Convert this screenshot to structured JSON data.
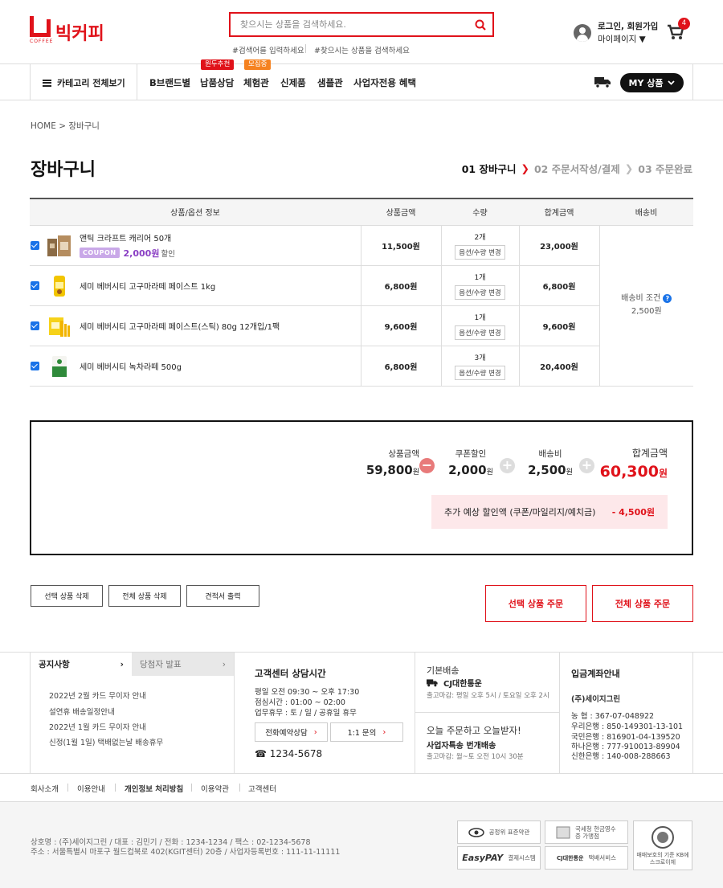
{
  "brand": {
    "name": "빅커피",
    "sub": "COFFEE"
  },
  "search": {
    "placeholder": "찾으시는 상품을 검색하세요.",
    "hint1": "#검색어를 입력하세요",
    "hint2": "#찾으시는 상품을 검색하세요"
  },
  "user": {
    "login": "로그인, 회원가입",
    "mypage": "마이페이지 ▼",
    "cart_count": "4"
  },
  "nav": {
    "category": "카테고리 전체보기",
    "items": [
      "B브랜드별",
      "납품상담",
      "체험관",
      "신제품",
      "샘플관",
      "사업자전용 혜택"
    ],
    "badge_consult": "원두추천",
    "badge_exp": "모집중",
    "my": "MY 상품"
  },
  "breadcrumb": "HOME  >  장바구니",
  "page_title": "장바구니",
  "steps": [
    "01 장바구니",
    "02 주문서작성/결제",
    "03 주문완료"
  ],
  "table": {
    "headers": [
      "상품/옵션 정보",
      "상품금액",
      "수량",
      "합계금액",
      "배송비"
    ],
    "rows": [
      {
        "name": "앤틱 크라프트 캐리어 50개",
        "price": "11,500원",
        "qty": "2개",
        "total": "23,000원",
        "coupon": "COUPON",
        "coupon_amt": "2,000원",
        "coupon_suffix": "할인"
      },
      {
        "name": "세미 베버시티 고구마라떼 페이스트 1kg",
        "price": "6,800원",
        "qty": "1개",
        "total": "6,800원"
      },
      {
        "name": "세미 베버시티 고구마라떼 페이스트(스틱) 80g 12개입/1팩",
        "price": "9,600원",
        "qty": "1개",
        "total": "9,600원"
      },
      {
        "name": "세미 베버시티 녹차라떼 500g",
        "price": "6,800원",
        "qty": "3개",
        "total": "20,400원"
      }
    ],
    "option_btn": "옵션/수량 변경",
    "ship_label": "배송비 조건",
    "ship_amt": "2,500원"
  },
  "summary": {
    "product_label": "상품금액",
    "product_val": "59,800",
    "coupon_label": "쿠폰할인",
    "coupon_val": "2,000",
    "ship_label": "배송비",
    "ship_val": "2,500",
    "total_label": "합계금액",
    "total_val": "60,300",
    "won": "원",
    "extra_label": "추가 예상 할인액 (쿠폰/마일리지/예치금)",
    "extra_val": "- 4,500원"
  },
  "actions": {
    "del_selected": "선택 상품 삭제",
    "del_all": "전체 상품 삭제",
    "estimate": "견적서 출력",
    "order_selected": "선택 상품 주문",
    "order_all": "전체 상품 주문"
  },
  "footer": {
    "notice_tab": "공지사항",
    "winner_tab": "당첨자 발표",
    "notices": [
      "2022년 2월 카드 무이자 안내",
      "설연휴 배송일정안내",
      "2022년 1월 카드 무이자 안내",
      "신정(1월 1일) 택배없는날 배송휴무"
    ],
    "cs_title": "고객센터 상담시간",
    "cs_lines": [
      "평일 오전 09:30 ~ 오후 17:30",
      "점심시간 : 01:00 ~ 02:00",
      "업무휴무 : 토 / 일 / 공휴일 휴무"
    ],
    "cs_btn1": "전화예약상담",
    "cs_btn2": "1:1 문의",
    "cs_phone": "☎ 1234-5678",
    "ship_title": "기본배송",
    "ship_company": "CJ대한통운",
    "ship_deadline": "출고마감: 평일 오후 5시 / 토요일 오후 2시",
    "ship2_title": "오늘 주문하고 오늘받자!",
    "ship2_sub": "사업자특송 번개배송",
    "ship2_deadline": "출고마감: 월~토 오전 10시 30분",
    "bank_title": "입금계좌안내",
    "bank_holder": "(주)세이지그린",
    "banks": [
      "농       협 : 367-07-048922",
      "우리은행 : 850-149301-13-101",
      "국민은행 : 816901-04-139520",
      "하나은행 : 777-910013-89904",
      "신한은행 : 140-008-288663"
    ],
    "links": [
      "회사소개",
      "이용안내",
      "개인정보 처리방침",
      "이용약관",
      "고객센터"
    ],
    "company1": "상호명 : (주)세이지그린 / 대표 : 김민기 / 전화 : 1234-1234 / 팩스 : 02-1234-5678",
    "company2": "주소 : 서울특별시 마포구 월드컵북로 402(KGIT센터) 20층 / 사업자등록번호 : 111-11-11111",
    "cert1": "공정위 표준약관",
    "cert2": "국세청 현금영수증 가맹점",
    "cert3_logo": "EasyPAY",
    "cert3": "결제시스템",
    "cert4_logo": "CJ대한통운",
    "cert4": "택배서비스",
    "cert5": "매매보호의 기준 KB에스크로이체"
  },
  "colors": {
    "accent": "#e0121a",
    "coupon": "#8a3fc4",
    "check": "#1a73e8"
  }
}
